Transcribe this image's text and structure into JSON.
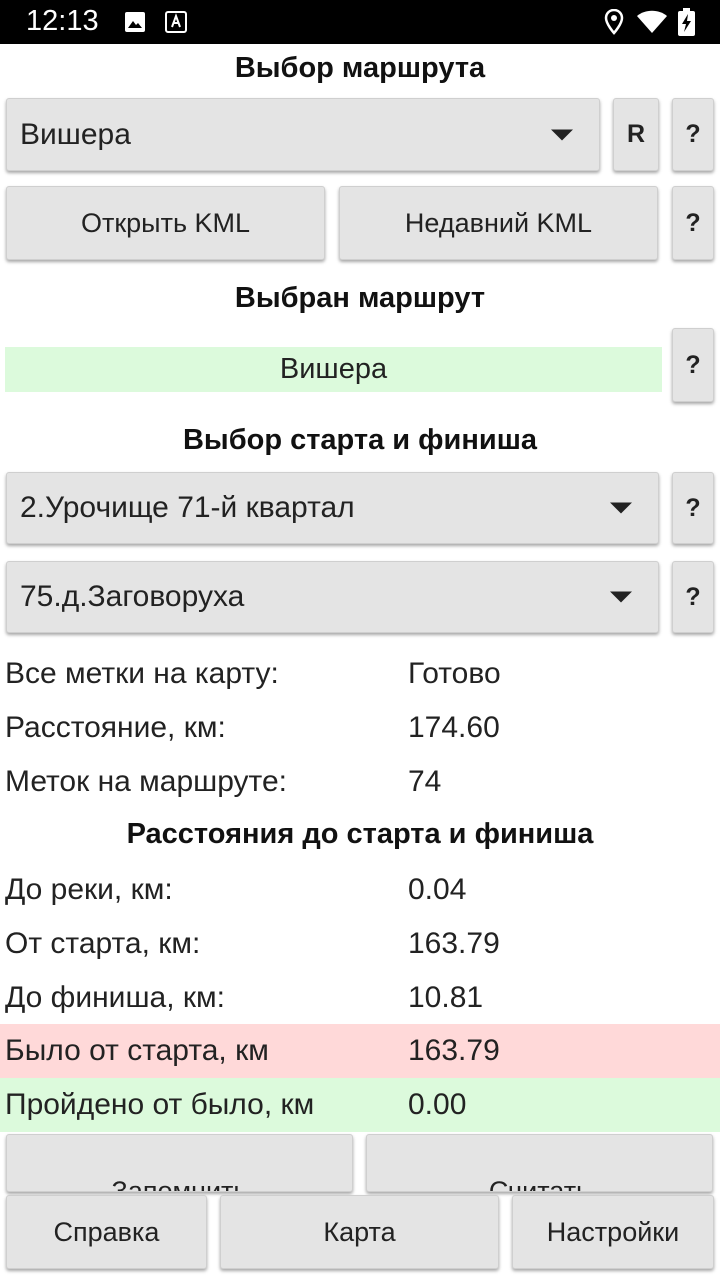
{
  "status_bar": {
    "time": "12:13",
    "icons": [
      "image-icon",
      "font-icon",
      "location-icon",
      "wifi-icon",
      "battery-charging-icon"
    ]
  },
  "route_select": {
    "heading": "Выбор маршрута",
    "spinner_value": "Вишера",
    "reset_label": "R",
    "help_label": "?"
  },
  "kml": {
    "open_label": "Открыть KML",
    "recent_label": "Недавний KML",
    "help_label": "?"
  },
  "selected_route": {
    "heading": "Выбран маршрут",
    "value": "Вишера",
    "help_label": "?"
  },
  "start_finish": {
    "heading": "Выбор старта и финиша",
    "start_value": "2.Урочище 71-й квартал",
    "finish_value": "75.д.Заговоруха",
    "help_label": "?"
  },
  "info": [
    {
      "label": "Все метки на карту:",
      "value": "Готово"
    },
    {
      "label": "Расстояние, км:",
      "value": "174.60"
    },
    {
      "label": "Меток на маршруте:",
      "value": "74"
    }
  ],
  "distances": {
    "heading": "Расстояния до старта и финиша",
    "rows": [
      {
        "label": "До реки, км:",
        "value": "0.04"
      },
      {
        "label": "От старта, км:",
        "value": "163.79"
      },
      {
        "label": "До финиша, км:",
        "value": "10.81"
      },
      {
        "label": "Было от старта, км",
        "value": "163.79"
      },
      {
        "label": "Пройдено от было, км",
        "value": "0.00"
      }
    ]
  },
  "actions": {
    "remember_label": "Запомнить",
    "read_label": "Считать",
    "help_label": "Справка",
    "map_label": "Карта",
    "settings_label": "Настройки"
  },
  "colors": {
    "highlight_green": "#dcfadc",
    "highlight_pink": "#ffd9d9",
    "button_bg": "#e4e4e4",
    "status_bar_bg": "#000000"
  }
}
